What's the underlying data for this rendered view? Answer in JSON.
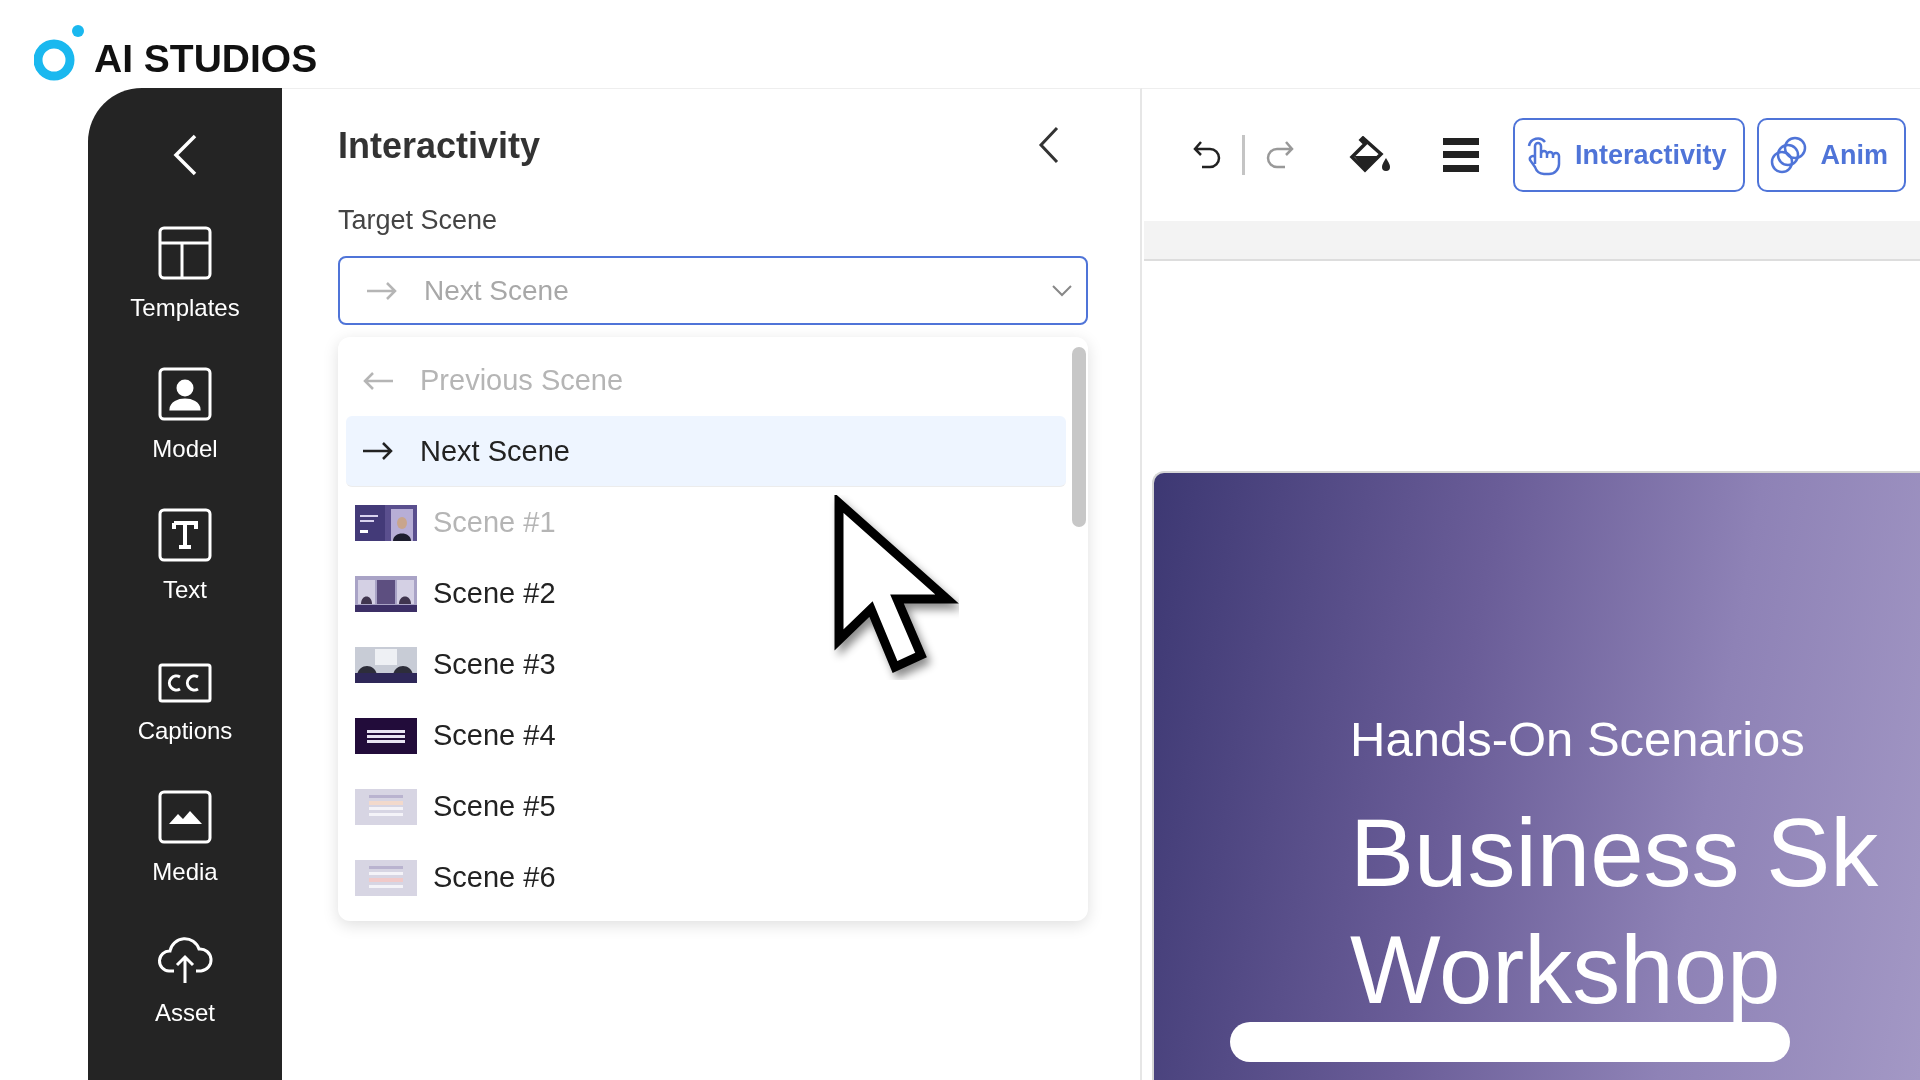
{
  "logo": {
    "text": "AI STUDIOS"
  },
  "sidebar": {
    "items": [
      {
        "label": "Templates",
        "kind": "templates"
      },
      {
        "label": "Model",
        "kind": "model"
      },
      {
        "label": "Text",
        "kind": "text"
      },
      {
        "label": "Captions",
        "kind": "captions"
      },
      {
        "label": "Media",
        "kind": "media"
      },
      {
        "label": "Asset",
        "kind": "asset"
      }
    ]
  },
  "panel": {
    "title": "Interactivity",
    "field_label": "Target Scene",
    "select": {
      "value": "Next Scene",
      "expanded": true
    },
    "options": [
      {
        "label": "Previous Scene",
        "kind": "previous",
        "selected": false,
        "disabled": true
      },
      {
        "label": "Next Scene",
        "kind": "next",
        "selected": true,
        "disabled": false
      },
      {
        "label": "Scene #1",
        "kind": "scene",
        "selected": false,
        "disabled": true
      },
      {
        "label": "Scene #2",
        "kind": "scene",
        "selected": false,
        "disabled": false
      },
      {
        "label": "Scene #3",
        "kind": "scene",
        "selected": false,
        "disabled": false
      },
      {
        "label": "Scene #4",
        "kind": "scene",
        "selected": false,
        "disabled": false
      },
      {
        "label": "Scene #5",
        "kind": "scene",
        "selected": false,
        "disabled": false
      },
      {
        "label": "Scene #6",
        "kind": "scene",
        "selected": false,
        "disabled": false
      }
    ]
  },
  "toolbar": {
    "tools": [
      {
        "kind": "undo",
        "disabled": false
      },
      {
        "kind": "redo",
        "disabled": true
      },
      {
        "kind": "fill",
        "disabled": false
      },
      {
        "kind": "menu",
        "disabled": false
      }
    ],
    "buttons": [
      {
        "label": "Interactivity",
        "kind": "interactivity"
      },
      {
        "label": "Anim",
        "kind": "animation"
      }
    ]
  },
  "slide": {
    "subtitle": "Hands-On Scenarios",
    "title_lines": [
      "Business Sk",
      "Workshop"
    ]
  }
}
